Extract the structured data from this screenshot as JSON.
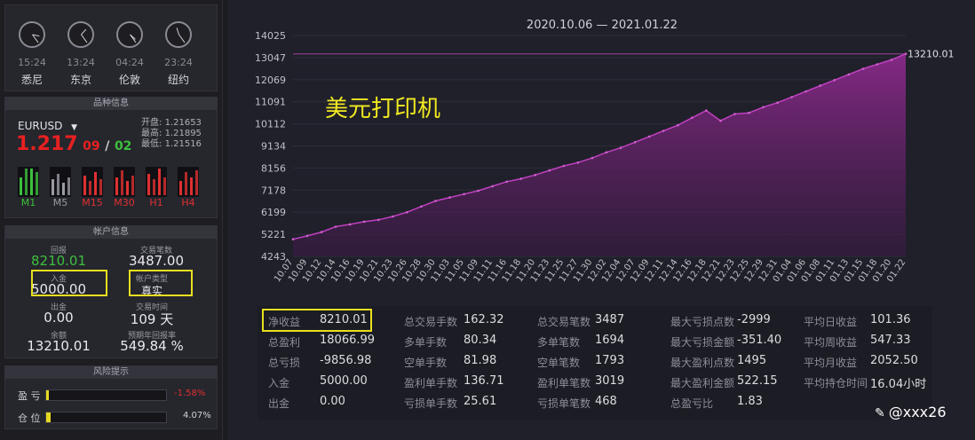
{
  "clocks": [
    {
      "time": "15:24",
      "city": "悉尼",
      "hour": 3,
      "minute": 24
    },
    {
      "time": "13:24",
      "city": "东京",
      "hour": 1,
      "minute": 24
    },
    {
      "time": "04:24",
      "city": "伦敦",
      "hour": 4,
      "minute": 24
    },
    {
      "time": "23:24",
      "city": "纽约",
      "hour": 11,
      "minute": 24
    }
  ],
  "symbol_panel": {
    "title": "品种信息",
    "symbol": "EURUSD",
    "price": "1.217",
    "price_small": "09",
    "price_slash": "/",
    "price_small2": "02",
    "open_label": "开盘:",
    "open": "1.21653",
    "high_label": "最高:",
    "high": "1.21895",
    "low_label": "最低:",
    "low": "1.21516",
    "timeframes": [
      "M1",
      "M5",
      "M15",
      "M30",
      "H1",
      "H4"
    ],
    "timeframe_colors": [
      "#3cc03c",
      "#9a9aa4",
      "#e03030",
      "#e03030",
      "#e03030",
      "#e03030"
    ]
  },
  "account_panel": {
    "title": "帐户信息",
    "items": [
      {
        "label": "回报",
        "value": "8210.01"
      },
      {
        "label": "交易笔数",
        "value": "3487.00"
      },
      {
        "label": "入金",
        "value": "5000.00"
      },
      {
        "label": "帐户类型",
        "value": "真实"
      },
      {
        "label": "出金",
        "value": "0.00"
      },
      {
        "label": "交易时间",
        "value": "109 天"
      },
      {
        "label": "余额",
        "value": "13210.01"
      },
      {
        "label": "预期年回报率",
        "value": "549.84 %"
      }
    ]
  },
  "risk_panel": {
    "title": "风险提示",
    "profit_label": "盈 亏",
    "profit_value": "-1.58%",
    "profit_fill": 0.0158,
    "position_label": "仓 位",
    "position_value": "4.07%",
    "position_fill": 0.0407
  },
  "chart_data": {
    "type": "area",
    "title": "2020.10.06 — 2021.01.22",
    "overlay_text": "美元打印机",
    "end_label": "13210.01",
    "yticks": [
      14025,
      13047,
      12069,
      11091,
      10112,
      9134,
      8156,
      7178,
      6199,
      5221,
      4243
    ],
    "ylim": [
      4243,
      14025
    ],
    "reference_line": 13210,
    "x": [
      "10.07",
      "10.09",
      "10.12",
      "10.14",
      "10.16",
      "10.19",
      "10.21",
      "10.23",
      "10.26",
      "10.28",
      "10.30",
      "11.03",
      "11.05",
      "11.09",
      "11.11",
      "11.16",
      "11.18",
      "11.20",
      "11.23",
      "11.25",
      "11.27",
      "11.30",
      "12.02",
      "12.04",
      "12.07",
      "12.09",
      "12.11",
      "12.14",
      "12.16",
      "12.18",
      "12.21",
      "12.23",
      "12.25",
      "12.29",
      "12.31",
      "01.04",
      "01.06",
      "01.08",
      "01.11",
      "01.13",
      "01.15",
      "01.18",
      "01.20",
      "01.22"
    ],
    "values": [
      5000,
      5150,
      5320,
      5560,
      5660,
      5780,
      5860,
      6010,
      6200,
      6450,
      6700,
      6850,
      7000,
      7150,
      7350,
      7550,
      7680,
      7850,
      8050,
      8250,
      8400,
      8600,
      8850,
      9050,
      9300,
      9550,
      9800,
      10050,
      10380,
      10700,
      10250,
      10550,
      10600,
      10850,
      11050,
      11300,
      11550,
      11800,
      12050,
      12300,
      12550,
      12750,
      12950,
      13210
    ]
  },
  "stats": {
    "col1": [
      {
        "label": "净收益",
        "value": "8210.01"
      },
      {
        "label": "总盈利",
        "value": "18066.99"
      },
      {
        "label": "总亏损",
        "value": "-9856.98"
      },
      {
        "label": "入金",
        "value": "5000.00"
      },
      {
        "label": "出金",
        "value": "0.00"
      }
    ],
    "col2": [
      {
        "label": "总交易手数",
        "value": "162.32"
      },
      {
        "label": "多单手数",
        "value": "80.34"
      },
      {
        "label": "空单手数",
        "value": "81.98"
      },
      {
        "label": "盈利单手数",
        "value": "136.71"
      },
      {
        "label": "亏损单手数",
        "value": "25.61"
      }
    ],
    "col3": [
      {
        "label": "总交易笔数",
        "value": "3487"
      },
      {
        "label": "多单笔数",
        "value": "1694"
      },
      {
        "label": "空单笔数",
        "value": "1793"
      },
      {
        "label": "盈利单笔数",
        "value": "3019"
      },
      {
        "label": "亏损单笔数",
        "value": "468"
      }
    ],
    "col4": [
      {
        "label": "最大亏损点数",
        "value": "-2999"
      },
      {
        "label": "最大亏损金额",
        "value": "-351.40"
      },
      {
        "label": "最大盈利点数",
        "value": "1495"
      },
      {
        "label": "最大盈利金额",
        "value": "522.15"
      },
      {
        "label": "总盈亏比",
        "value": "1.83"
      }
    ],
    "col5": [
      {
        "label": "平均日收益",
        "value": "101.36"
      },
      {
        "label": "平均周收益",
        "value": "547.33"
      },
      {
        "label": "平均月收益",
        "value": "2052.50"
      },
      {
        "label": "平均持仓时间",
        "value": "16.04小时"
      }
    ]
  },
  "watermark": "@xxx26"
}
